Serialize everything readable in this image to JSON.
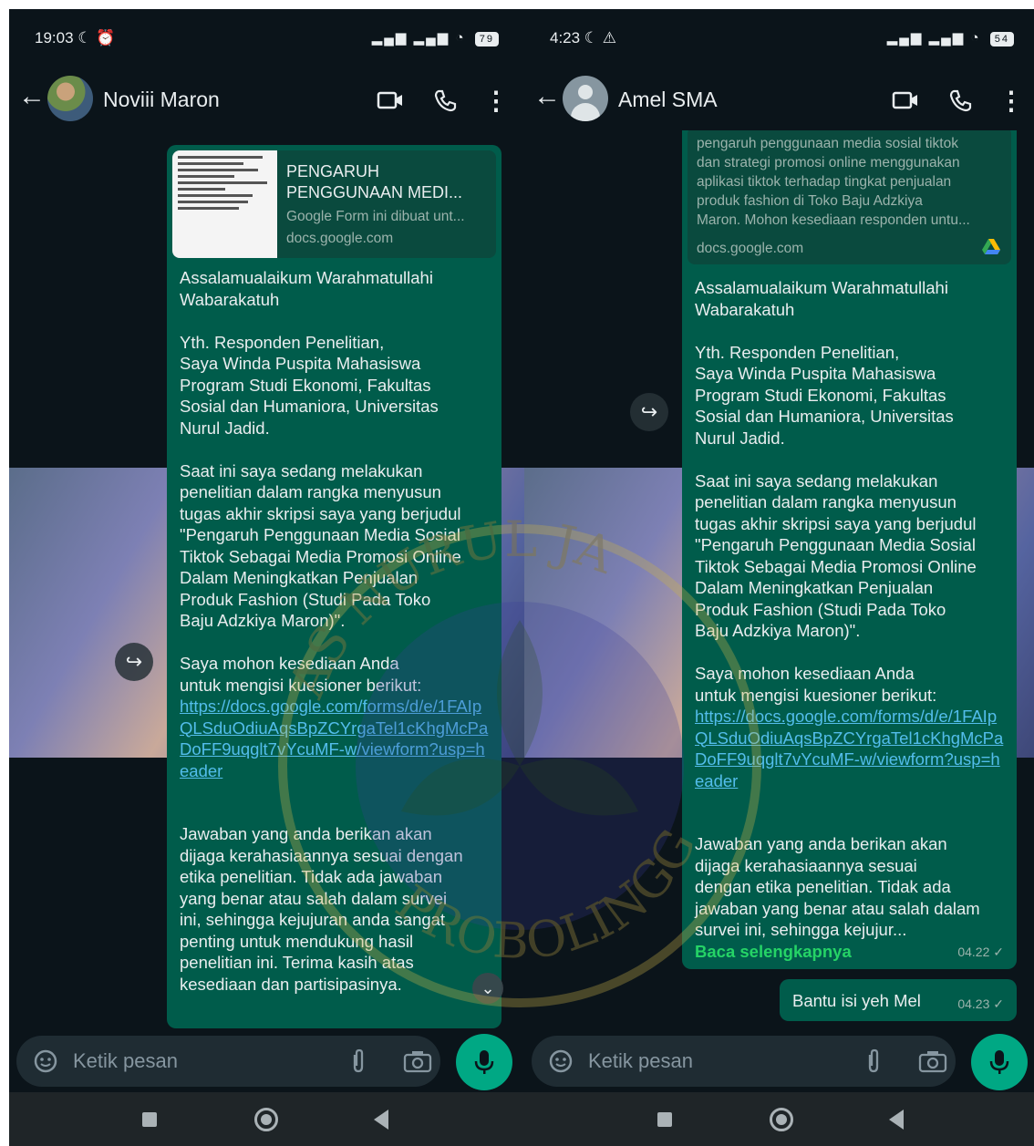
{
  "left": {
    "status": {
      "time": "19:03 ☾ ⏰",
      "battery": "79"
    },
    "header": {
      "contact_name": "Noviii Maron"
    },
    "link_preview": {
      "title": "PENGARUH PENGGUNAAN MEDI...",
      "description": "Google Form ini dibuat unt...",
      "domain": "docs.google.com"
    },
    "message": {
      "body": "Assalamualaikum Warahmatullahi\nWabarakatuh\n\nYth. Responden Penelitian,\nSaya Winda Puspita Mahasiswa\nProgram Studi Ekonomi, Fakultas\nSosial dan Humaniora, Universitas\nNurul Jadid.\n\nSaat ini saya sedang melakukan\npenelitian dalam rangka menyusun\ntugas akhir skripsi saya yang berjudul\n\"Pengaruh Penggunaan Media Sosial\nTiktok Sebagai Media Promosi Online\nDalam Meningkatkan Penjualan\nProduk Fashion (Studi Pada Toko\nBaju Adzkiya Maron)\".\n\nSaya mohon kesediaan Anda\nuntuk mengisi kuesioner berikut:",
      "link": "https://docs.google.com/forms/d/e/1FAIpQLSduOdiuAqsBpZCYrgaTel1cKhgMcPaDoFF9uqglt7vYcuMF-w/viewform?usp=header",
      "closing": "Jawaban yang anda berikan akan\ndijaga kerahasiaannya sesuai dengan\netika penelitian. Tidak ada jawaban\nyang benar atau salah dalam survei\nini, sehingga kejujuran anda sangat\npenting untuk mendukung hasil\npenelitian ini. Terima kasih atas\nkesediaan dan partisipasinya."
    },
    "input": {
      "placeholder": "Ketik pesan"
    }
  },
  "right": {
    "status": {
      "time": "4:23 ☾ ⚠",
      "battery": "54"
    },
    "header": {
      "contact_name": "Amel SMA"
    },
    "link_preview": {
      "description": "pengaruh penggunaan media sosial tiktok\ndan strategi promosi online menggunakan\naplikasi tiktok terhadap tingkat penjualan\nproduk fashion di Toko Baju Adzkiya\nMaron. Mohon kesediaan responden untu...",
      "domain": "docs.google.com"
    },
    "message": {
      "body": "Assalamualaikum Warahmatullahi\nWabarakatuh\n\nYth. Responden Penelitian,\nSaya Winda Puspita Mahasiswa\nProgram Studi Ekonomi, Fakultas\nSosial dan Humaniora, Universitas\nNurul Jadid.\n\nSaat ini saya sedang melakukan\npenelitian dalam rangka menyusun\ntugas akhir skripsi saya yang berjudul\n\"Pengaruh Penggunaan Media Sosial\nTiktok Sebagai Media Promosi Online\nDalam Meningkatkan Penjualan\nProduk Fashion (Studi Pada Toko\nBaju Adzkiya Maron)\".\n\nSaya mohon kesediaan Anda\nuntuk mengisi kuesioner berikut:",
      "link": "https://docs.google.com/forms/d/e/1FAIpQLSduOdiuAqsBpZCYrgaTel1cKhgMcPaDoFF9uqglt7vYcuMF-w/viewform?usp=header",
      "closing": "Jawaban yang anda berikan akan\ndijaga kerahasiaannya sesuai\ndengan etika penelitian. Tidak ada\njawaban yang benar atau salah dalam\nsurvei ini, sehingga kejujur...",
      "read_more": "Baca selengkapnya",
      "time": "04.22 ✓"
    },
    "reply": {
      "text": "Bantu isi yeh Mel",
      "time": "04.23 ✓"
    },
    "input": {
      "placeholder": "Ketik pesan"
    }
  },
  "watermark": {
    "text_top": "AS NURUL JA",
    "text_bottom": "PROBOLINGGO"
  },
  "colors": {
    "bubble": "#005c4b",
    "background": "#0b141a",
    "accent": "#00a884",
    "link": "#53bdeb"
  }
}
